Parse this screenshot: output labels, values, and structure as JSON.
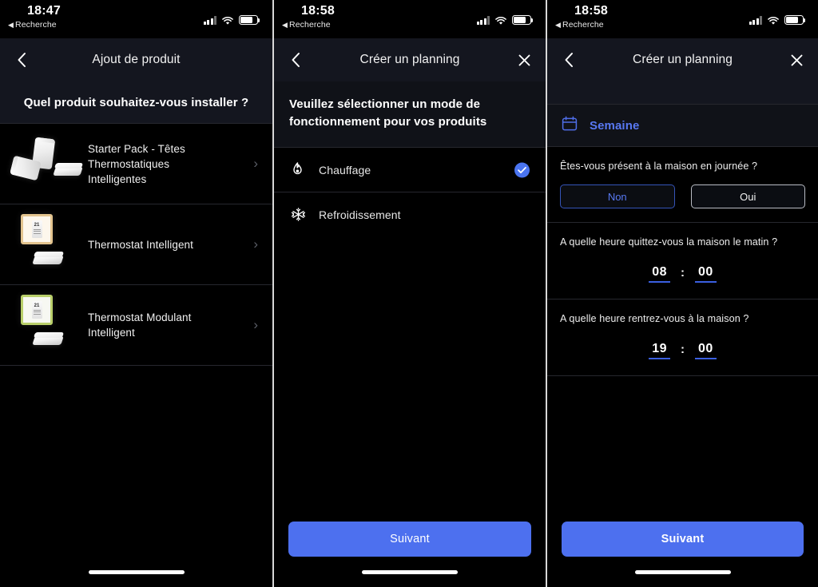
{
  "panels": [
    {
      "status": {
        "time": "18:47",
        "back": "Recherche",
        "back_arrow": "◀"
      },
      "nav": {
        "title": "Ajout de produit",
        "back_icon": "chevron-left"
      },
      "question": "Quel produit souhaitez-vous installer ?",
      "products": [
        {
          "name": "Starter Pack - Têtes Thermostatiques Intelligentes",
          "chevron": "›",
          "thumb": "valve-pack"
        },
        {
          "name": "Thermostat Intelligent",
          "chevron": "›",
          "thumb": "thermostat-cream"
        },
        {
          "name": "Thermostat Modulant Intelligent",
          "chevron": "›",
          "thumb": "thermostat-green"
        }
      ]
    },
    {
      "status": {
        "time": "18:58",
        "back": "Recherche",
        "back_arrow": "◀"
      },
      "nav": {
        "title": "Créer un planning",
        "back_icon": "chevron-left",
        "close_icon": "close"
      },
      "intro": "Veuillez sélectionner un mode de fonctionnement pour vos produits",
      "modes": [
        {
          "label": "Chauffage",
          "icon": "flame-icon",
          "glyph": "🔥",
          "selected": true
        },
        {
          "label": "Refroidissement",
          "icon": "snowflake-icon",
          "glyph": "❄",
          "selected": false
        }
      ],
      "next_label": "Suivant"
    },
    {
      "status": {
        "time": "18:58",
        "back": "Recherche",
        "back_arrow": "◀"
      },
      "nav": {
        "title": "Créer un planning",
        "back_icon": "chevron-left",
        "close_icon": "close"
      },
      "week": {
        "label": "Semaine",
        "icon": "calendar-icon"
      },
      "questions": [
        {
          "text": "Êtes-vous présent à la maison en journée ?",
          "options": [
            {
              "label": "Non",
              "selected": true
            },
            {
              "label": "Oui",
              "selected": false
            }
          ]
        },
        {
          "text": "A quelle heure quittez-vous la maison le matin ?",
          "hour": "08",
          "separator": ":",
          "minute": "00"
        },
        {
          "text": "A quelle heure rentrez-vous à la maison ?",
          "hour": "19",
          "separator": ":",
          "minute": "00"
        }
      ],
      "next_label": "Suivant"
    }
  ],
  "colors": {
    "accent_blue": "#4d70ef",
    "link_blue": "#5878f2",
    "underline_blue": "#3b5fe0",
    "panel_bg": "#000000",
    "nav_bg": "#14161f",
    "divider": "#26272e"
  }
}
